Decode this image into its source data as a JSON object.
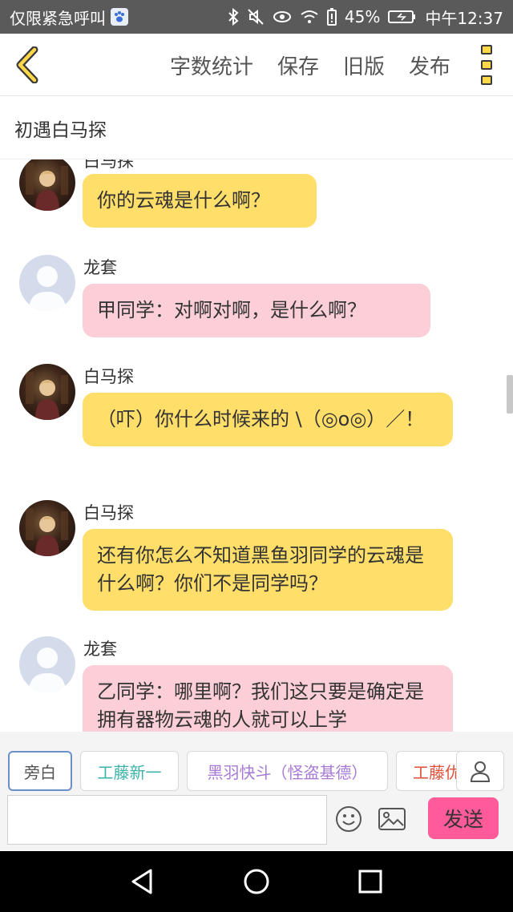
{
  "status_bar": {
    "left_text": "仅限紧急呼叫",
    "battery_percent": "45%",
    "time": "中午12:37"
  },
  "header": {
    "actions": [
      "字数统计",
      "保存",
      "旧版",
      "发布"
    ]
  },
  "title": "初遇白马探",
  "messages": [
    {
      "sender": "白马探",
      "text": "你的云魂是什么啊？",
      "style": "yellow",
      "avatar": "character"
    },
    {
      "sender": "龙套",
      "text": "甲同学：对啊对啊，是什么啊？",
      "style": "pink",
      "avatar": "default"
    },
    {
      "sender": "白马探",
      "text": "（吓）你什么时候来的 \\（◎o◎）／！",
      "style": "yellow",
      "avatar": "character"
    },
    {
      "sender": "白马探",
      "text": "还有你怎么不知道黑鱼羽同学的云魂是什么啊？你们不是同学吗？",
      "style": "yellow",
      "avatar": "character"
    },
    {
      "sender": "龙套",
      "text": "乙同学：哪里啊？我们这只要是确定是拥有器物云魂的人就可以上学",
      "style": "pink",
      "avatar": "default"
    }
  ],
  "roles": [
    {
      "label": "旁白",
      "color": "#555555",
      "selected": true
    },
    {
      "label": "工藤新一",
      "color": "#3bb3a8",
      "selected": false
    },
    {
      "label": "黑羽快斗（怪盗基德）",
      "color": "#a87ad6",
      "selected": false
    },
    {
      "label": "工藤优",
      "color": "#e0503a",
      "selected": false
    }
  ],
  "input": {
    "value": "",
    "placeholder": ""
  },
  "send_label": "发送",
  "colors": {
    "bubble_yellow": "#ffde6a",
    "bubble_pink": "#fccfd8",
    "send_button": "#ff5a9a",
    "accent_yellow": "#ffd84a"
  },
  "icons": {
    "back": "chevron-left-icon",
    "more": "more-vertical-icon",
    "user": "user-icon",
    "emoji": "smiley-icon",
    "image": "image-icon"
  }
}
